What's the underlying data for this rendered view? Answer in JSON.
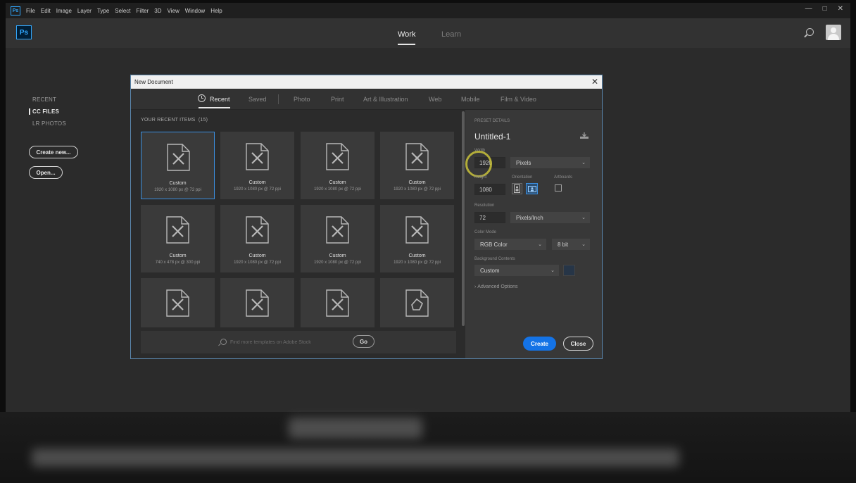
{
  "menubar": {
    "items": [
      "File",
      "Edit",
      "Image",
      "Layer",
      "Type",
      "Select",
      "Filter",
      "3D",
      "View",
      "Window",
      "Help"
    ],
    "win_controls": [
      "—",
      "□",
      "✕"
    ]
  },
  "app": {
    "logo_text": "Ps",
    "tabs": [
      "Work",
      "Learn"
    ]
  },
  "leftnav": {
    "items": [
      "RECENT",
      "CC FILES",
      "LR PHOTOS"
    ],
    "create_label": "Create new...",
    "open_label": "Open..."
  },
  "dialog": {
    "title": "New Document",
    "close_glyph": "✕",
    "tabs": [
      "Recent",
      "Saved",
      "Photo",
      "Print",
      "Art & Illustration",
      "Web",
      "Mobile",
      "Film & Video"
    ],
    "recent_header": "YOUR RECENT ITEMS",
    "recent_count": "(15)",
    "items": [
      {
        "name": "Custom",
        "dims": "1920 x 1080 px @ 72 ppi"
      },
      {
        "name": "Custom",
        "dims": "1920 x 1080 px @ 72 ppi"
      },
      {
        "name": "Custom",
        "dims": "1920 x 1080 px @ 72 ppi"
      },
      {
        "name": "Custom",
        "dims": "1920 x 1080 px @ 72 ppi"
      },
      {
        "name": "Custom",
        "dims": "740 x 478 px @ 300 ppi"
      },
      {
        "name": "Custom",
        "dims": "1920 x 1080 px @ 72 ppi"
      },
      {
        "name": "Custom",
        "dims": "1920 x 1080 px @ 72 ppi"
      },
      {
        "name": "Custom",
        "dims": "1920 x 1080 px @ 72 ppi"
      },
      {
        "name": "",
        "dims": ""
      },
      {
        "name": "",
        "dims": ""
      },
      {
        "name": "",
        "dims": ""
      },
      {
        "name": "",
        "dims": ""
      }
    ],
    "stock_placeholder": "Find more templates on Adobe Stock",
    "go_label": "Go"
  },
  "details": {
    "header": "PRESET DETAILS",
    "doc_name": "Untitled-1",
    "width_label": "Width",
    "width": "1920",
    "width_unit": "Pixels",
    "height_label": "Height",
    "height": "1080",
    "orientation_label": "Orientation",
    "artboards_label": "Artboards",
    "resolution_label": "Resolution",
    "resolution": "72",
    "resolution_unit": "Pixels/Inch",
    "color_mode_label": "Color Mode",
    "color_mode": "RGB Color",
    "bit_depth": "8 bit",
    "bg_label": "Background Contents",
    "bg_value": "Custom",
    "bg_color": "#263547",
    "advanced_label": "Advanced Options",
    "create_label": "Create",
    "close_label": "Close"
  },
  "colors": {
    "accent": "#1473e6",
    "ps_blue": "#31a8ff",
    "selection": "#3b8fe0"
  }
}
